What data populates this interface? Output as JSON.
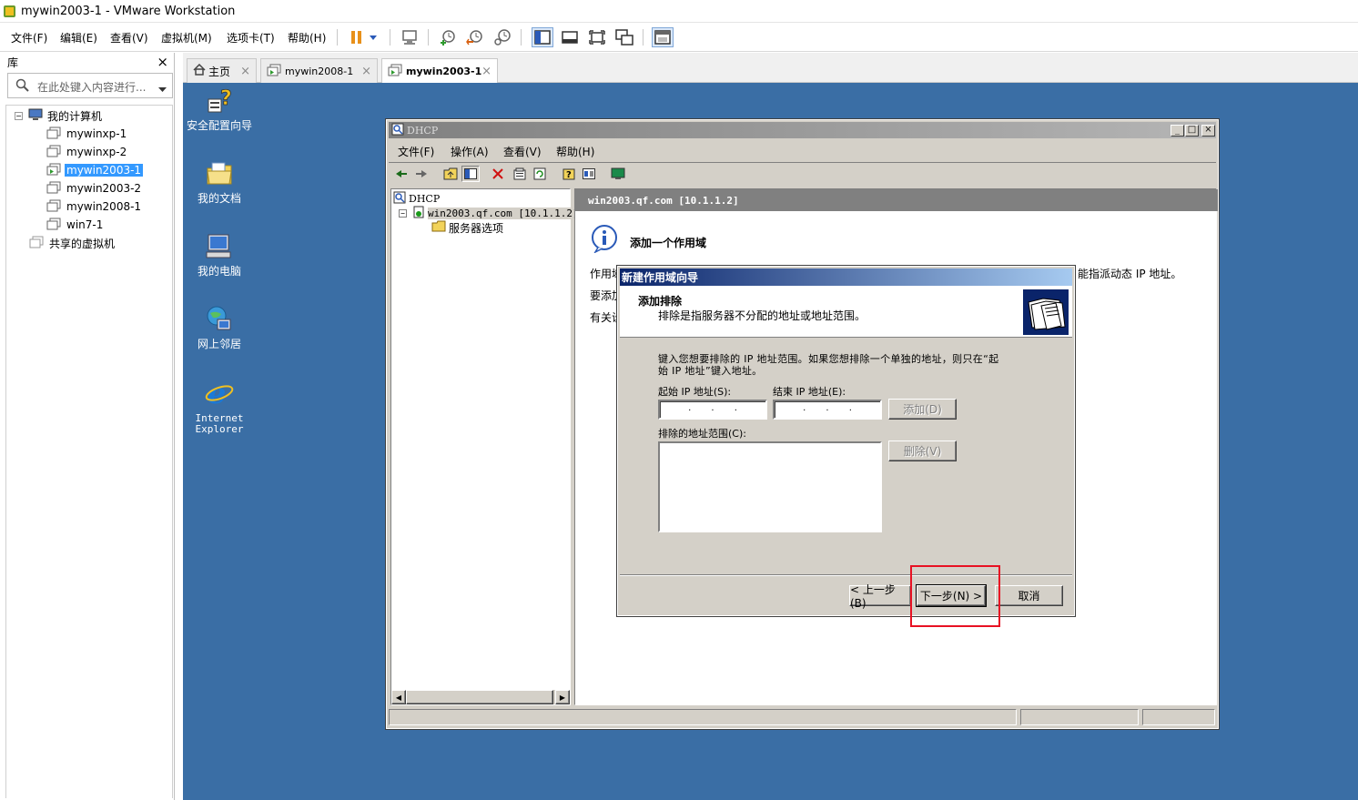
{
  "window": {
    "title": "mywin2003-1 - VMware Workstation"
  },
  "menubar": {
    "items": [
      "文件(F)",
      "编辑(E)",
      "查看(V)",
      "虚拟机(M)",
      "选项卡(T)",
      "帮助(H)"
    ]
  },
  "toolbar": {
    "icons": [
      "pause-icon",
      "dropdown-icon",
      "send-ctrl-alt-del-icon",
      "snapshot-take-icon",
      "snapshot-revert-icon",
      "snapshot-manager-icon",
      "library-view-icon",
      "console-view-icon",
      "fullscreen-icon",
      "unity-icon",
      "thumbnail-view-icon"
    ]
  },
  "library": {
    "title": "库",
    "close": "×",
    "search_placeholder": "在此处键入内容进行...",
    "tree": {
      "root": "我的计算机",
      "vms": [
        "mywinxp-1",
        "mywinxp-2",
        "mywin2003-1",
        "mywin2003-2",
        "mywin2008-1",
        "win7-1"
      ],
      "selected": "mywin2003-1",
      "shared": "共享的虚拟机"
    }
  },
  "tabs": [
    {
      "label": "主页",
      "close": "×"
    },
    {
      "label": "mywin2008-1",
      "close": "×"
    },
    {
      "label": "mywin2003-1",
      "close": "×",
      "active": true
    }
  ],
  "desktop": {
    "icons": [
      "安全配置向导",
      "我的文档",
      "我的电脑",
      "网上邻居",
      "Internet Explorer"
    ],
    "background": "#3a6ea5"
  },
  "dhcp": {
    "title": "DHCP",
    "controls": [
      "_",
      "□",
      "×"
    ],
    "menu": [
      "文件(F)",
      "操作(A)",
      "查看(V)",
      "帮助(H)"
    ],
    "tree": {
      "root": "DHCP",
      "server": "win2003.qf.com [10.1.1.2]",
      "options": "服务器选项"
    },
    "detail_header": "win2003.qf.com [10.1.1.2]",
    "info_title": "添加一个作用域",
    "lines": [
      "作用域",
      "要添加",
      "有关设"
    ],
    "line_tail": "能指派动态 IP 地址。"
  },
  "wizard": {
    "title": "新建作用域向导",
    "header_title": "添加排除",
    "header_desc": "排除是指服务器不分配的地址或地址范围。",
    "instruction_line1": "键入您想要排除的 IP 地址范围。如果您想排除一个单独的地址，则只在“起",
    "instruction_line2": "始 IP 地址”键入地址。",
    "start_ip_label": "起始 IP 地址(S):",
    "end_ip_label": "结束 IP 地址(E):",
    "add_button": "添加(D)",
    "excluded_label": "排除的地址范围(C):",
    "remove_button": "删除(V)",
    "back_button": "< 上一步(B)",
    "next_button": "下一步(N) >",
    "cancel_button": "取消"
  },
  "colors": {
    "desktop": "#3a6ea5",
    "highlight": "#e81123",
    "selection": "#3399ff",
    "wizard_title": "#0a246a"
  }
}
